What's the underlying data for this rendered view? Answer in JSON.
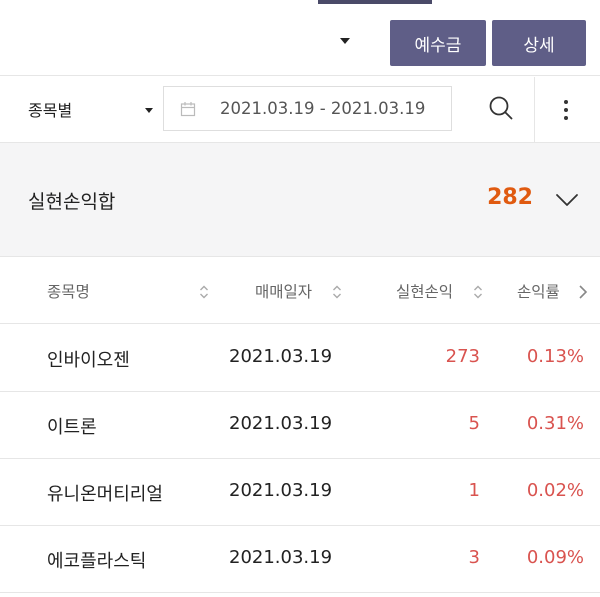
{
  "header": {
    "buttons": {
      "deposit": "예수금",
      "detail": "상세"
    }
  },
  "filter": {
    "select": "종목별",
    "date_range": "2021.03.19  -  2021.03.19"
  },
  "summary": {
    "label": "실현손익합",
    "value": "282"
  },
  "table": {
    "columns": [
      "종목명",
      "매매일자",
      "실현손익",
      "손익률"
    ],
    "rows": [
      {
        "name": "인바이오젠",
        "date": "2021.03.19",
        "pnl": "273",
        "rate": "0.13%"
      },
      {
        "name": "이트론",
        "date": "2021.03.19",
        "pnl": "5",
        "rate": "0.31%"
      },
      {
        "name": "유니온머티리얼",
        "date": "2021.03.19",
        "pnl": "1",
        "rate": "0.02%"
      },
      {
        "name": "에코플라스틱",
        "date": "2021.03.19",
        "pnl": "3",
        "rate": "0.09%"
      }
    ]
  },
  "colors": {
    "button_bg": "#5f5e87",
    "summary_value": "#e05a10",
    "profit": "#d9534f",
    "summary_bg": "#f5f5f6"
  },
  "icons": [
    "calendar-icon",
    "search-icon",
    "more-vertical-icon",
    "chevron-down-icon",
    "sort-icon",
    "chevron-right-icon"
  ]
}
